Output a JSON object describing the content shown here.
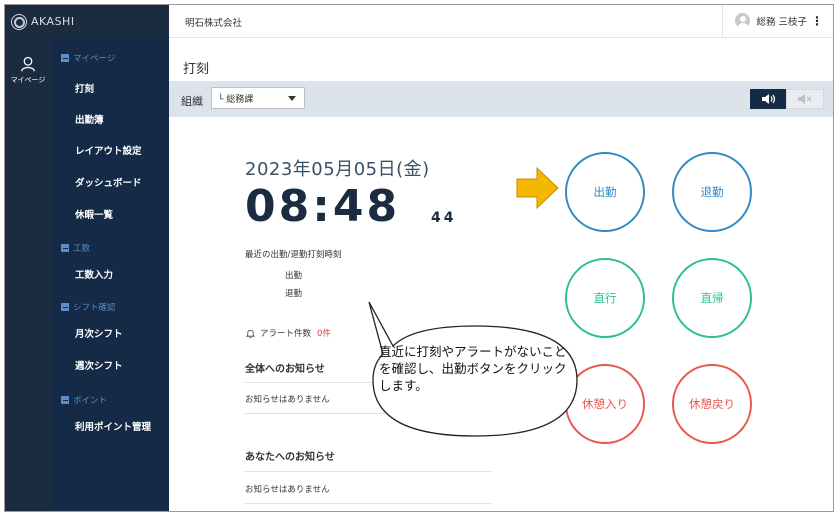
{
  "app": {
    "logo_text": "AKASHI"
  },
  "rail": {
    "label": "マイページ"
  },
  "header": {
    "company": "明石株式会社",
    "user_name": "総務 三枝子",
    "menu_glyph": "⋮"
  },
  "page": {
    "title": "打刻"
  },
  "sidebar": {
    "sections": [
      {
        "label": "マイページ",
        "items": [
          "打刻",
          "出勤簿",
          "レイアウト設定",
          "ダッシュボード",
          "休暇一覧"
        ]
      },
      {
        "label": "工数",
        "items": [
          "工数入力"
        ]
      },
      {
        "label": "シフト確認",
        "items": [
          "月次シフト",
          "週次シフト"
        ]
      },
      {
        "label": "ポイント",
        "items": [
          "利用ポイント管理"
        ]
      }
    ]
  },
  "toolbar": {
    "org_label": "組織",
    "org_value": "└ 総務課"
  },
  "clock": {
    "date": "2023年05月05日(金)",
    "time": "08:48",
    "seconds": "44"
  },
  "recent": {
    "title": "最近の出勤/退勤打刻時刻",
    "in_label": "出勤",
    "out_label": "退勤"
  },
  "alert": {
    "label": "アラート件数",
    "count": "0件"
  },
  "notices": {
    "all_title": "全体へのお知らせ",
    "all_empty": "お知らせはありません",
    "you_title": "あなたへのお知らせ",
    "you_empty": "お知らせはありません"
  },
  "buttons": {
    "clock_in": "出勤",
    "clock_out": "退勤",
    "direct_go": "直行",
    "direct_return": "直帰",
    "break_start": "休憩入り",
    "break_end": "休憩戻り"
  },
  "annotation": {
    "text": "直近に打刻やアラートがないことを確認し、出勤ボタンをクリックします。"
  },
  "colors": {
    "sidebar_bg": "#152a47",
    "section_label": "#5b8ec9",
    "blue_button": "#2e8bc4",
    "green_button": "#2bbf93",
    "red_button": "#e8584c",
    "arrow_fill": "#f5b800",
    "alert_count": "#e53935"
  },
  "icons": {
    "logo": "akashi-logo-icon",
    "rail": "person-icon",
    "alert": "bell-icon",
    "sound_on": "speaker-on-icon",
    "sound_off": "speaker-mute-icon",
    "pointer": "right-arrow-icon"
  }
}
